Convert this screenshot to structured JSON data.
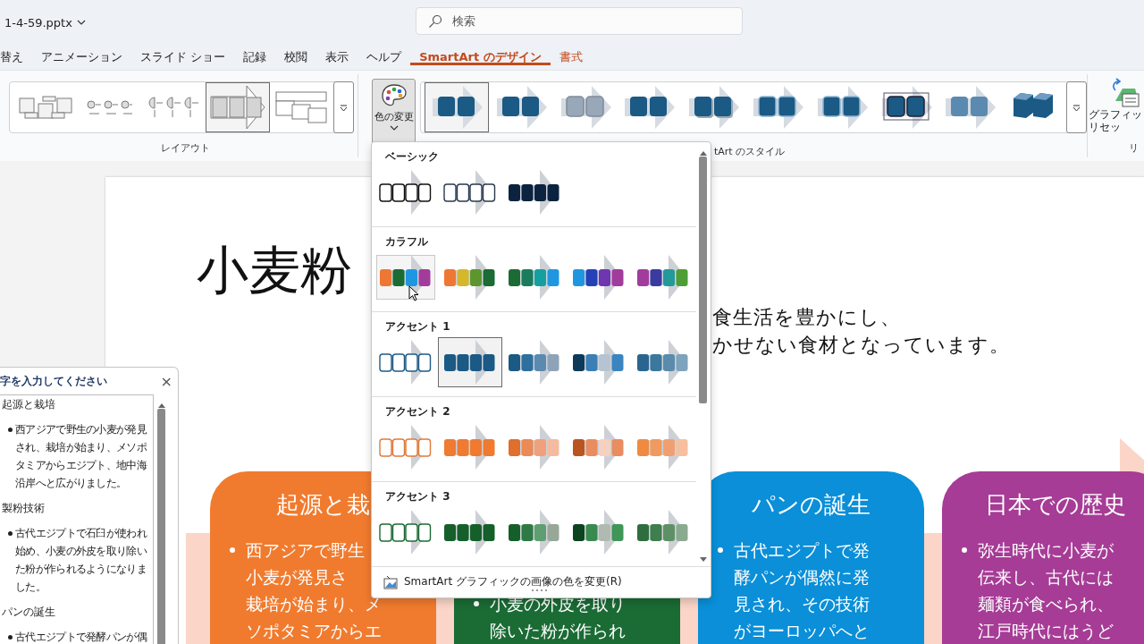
{
  "title_bar": {
    "file_name": "1-4-59.pptx",
    "search": {
      "placeholder": "検索"
    }
  },
  "tabs": [
    {
      "label": "替え",
      "selected": false,
      "kind": "normal"
    },
    {
      "label": "アニメーション",
      "selected": false,
      "kind": "normal"
    },
    {
      "label": "スライド ショー",
      "selected": false,
      "kind": "normal"
    },
    {
      "label": "記録",
      "selected": false,
      "kind": "normal"
    },
    {
      "label": "校閲",
      "selected": false,
      "kind": "normal"
    },
    {
      "label": "表示",
      "selected": false,
      "kind": "normal"
    },
    {
      "label": "ヘルプ",
      "selected": false,
      "kind": "normal"
    },
    {
      "label": "SmartArt のデザイン",
      "selected": true,
      "kind": "contextual"
    },
    {
      "label": "書式",
      "selected": false,
      "kind": "contextual"
    }
  ],
  "ribbon": {
    "layouts": [
      {
        "kind": "cycle",
        "selected": false
      },
      {
        "kind": "dots",
        "selected": false
      },
      {
        "kind": "half-circles",
        "selected": false
      },
      {
        "kind": "arrow-boxes",
        "selected": true
      },
      {
        "kind": "stacked",
        "selected": false
      }
    ],
    "layout_group": "レイアウト",
    "change_colors": {
      "label": "色の変更",
      "expanded": true
    },
    "styles": [
      {
        "kind": "flat",
        "selected": true
      },
      {
        "kind": "flat",
        "selected": false
      },
      {
        "kind": "gray",
        "selected": false
      },
      {
        "kind": "flat",
        "selected": false
      },
      {
        "kind": "shadow",
        "selected": false
      },
      {
        "kind": "bevel",
        "selected": false
      },
      {
        "kind": "bevel",
        "selected": false
      },
      {
        "kind": "outline",
        "selected": false
      },
      {
        "kind": "faded",
        "selected": false
      },
      {
        "kind": "cube",
        "selected": false
      }
    ],
    "styles_group": "tArt のスタイル",
    "reset": {
      "lines": [
        "グラフィッ",
        "リセッ"
      ]
    },
    "reset_group": "リ"
  },
  "color_menu": {
    "sections": [
      {
        "name": "ベーシック",
        "items": [
          {
            "kind": "outline",
            "boxes": [
              {
                "color": "#111111"
              },
              {
                "color": "#111111"
              },
              {
                "color": "#111111"
              },
              {
                "color": "#111111"
              }
            ],
            "selected": false,
            "hovered": false
          },
          {
            "kind": "outline",
            "boxes": [
              {
                "color": "#2a3a50"
              },
              {
                "color": "#2a3a50"
              },
              {
                "color": "#2a3a50"
              },
              {
                "color": "#2a3a50"
              }
            ],
            "selected": false,
            "hovered": false
          },
          {
            "kind": "fill",
            "boxes": [
              {
                "color": "#0c2340"
              },
              {
                "color": "#0c2340"
              },
              {
                "color": "#0c2340"
              },
              {
                "color": "#0c2340"
              }
            ],
            "selected": false,
            "hovered": false
          }
        ]
      },
      {
        "name": "カラフル",
        "items": [
          {
            "kind": "fill",
            "boxes": [
              {
                "color": "#ee7733"
              },
              {
                "color": "#1b6b35"
              },
              {
                "color": "#1f97e0"
              },
              {
                "color": "#a23c9c"
              }
            ],
            "selected": false,
            "hovered": true
          },
          {
            "kind": "fill",
            "boxes": [
              {
                "color": "#ee7733"
              },
              {
                "color": "#d4b82a"
              },
              {
                "color": "#5d962f"
              },
              {
                "color": "#1b6b35"
              }
            ],
            "selected": false,
            "hovered": false
          },
          {
            "kind": "fill",
            "boxes": [
              {
                "color": "#1b6b35"
              },
              {
                "color": "#1a7c5c"
              },
              {
                "color": "#14a0a0"
              },
              {
                "color": "#1f97e0"
              }
            ],
            "selected": false,
            "hovered": false
          },
          {
            "kind": "fill",
            "boxes": [
              {
                "color": "#1f97e0"
              },
              {
                "color": "#2541b8"
              },
              {
                "color": "#7035b0"
              },
              {
                "color": "#a23c9c"
              }
            ],
            "selected": false,
            "hovered": false
          },
          {
            "kind": "fill",
            "boxes": [
              {
                "color": "#a23c9c"
              },
              {
                "color": "#3a3ba0"
              },
              {
                "color": "#23999a"
              },
              {
                "color": "#4f9e35"
              }
            ],
            "selected": false,
            "hovered": false
          }
        ]
      },
      {
        "name": "アクセント 1",
        "items": [
          {
            "kind": "outline",
            "boxes": [
              {
                "color": "#1f5b85"
              },
              {
                "color": "#1f5b85"
              },
              {
                "color": "#1f5b85"
              },
              {
                "color": "#1f5b85"
              }
            ],
            "selected": false,
            "hovered": false
          },
          {
            "kind": "fill",
            "boxes": [
              {
                "color": "#1a5a84"
              },
              {
                "color": "#1a5a84"
              },
              {
                "color": "#1a5a84"
              },
              {
                "color": "#1a5a84"
              }
            ],
            "selected": true,
            "hovered": false
          },
          {
            "kind": "fill",
            "boxes": [
              {
                "color": "#1a5a84"
              },
              {
                "color": "#2e6f9e"
              },
              {
                "color": "#5a8ab0"
              },
              {
                "color": "#8fa3b8"
              }
            ],
            "selected": false,
            "hovered": false
          },
          {
            "kind": "fill",
            "boxes": [
              {
                "color": "#0e3a5a"
              },
              {
                "color": "#3a7fb5"
              },
              {
                "color": "#b6c4d2"
              },
              {
                "color": "#3a85c0"
              }
            ],
            "selected": false,
            "hovered": false
          },
          {
            "kind": "fill",
            "boxes": [
              {
                "color": "#2a6590"
              },
              {
                "color": "#3a789e"
              },
              {
                "color": "#5a8aac"
              },
              {
                "color": "#7ea3bd"
              }
            ],
            "selected": false,
            "hovered": false
          }
        ]
      },
      {
        "name": "アクセント 2",
        "items": [
          {
            "kind": "outline",
            "boxes": [
              {
                "color": "#e07a3a"
              },
              {
                "color": "#e07a3a"
              },
              {
                "color": "#e07a3a"
              },
              {
                "color": "#e07a3a"
              }
            ],
            "selected": false,
            "hovered": false
          },
          {
            "kind": "fill",
            "boxes": [
              {
                "color": "#ef7a30"
              },
              {
                "color": "#ef7a30"
              },
              {
                "color": "#ef7a30"
              },
              {
                "color": "#ef7a30"
              }
            ],
            "selected": false,
            "hovered": false
          },
          {
            "kind": "fill",
            "boxes": [
              {
                "color": "#e06e2c"
              },
              {
                "color": "#ea8a55"
              },
              {
                "color": "#f0a07a"
              },
              {
                "color": "#f4bba0"
              }
            ],
            "selected": false,
            "hovered": false
          },
          {
            "kind": "fill",
            "boxes": [
              {
                "color": "#b85520"
              },
              {
                "color": "#e88d60"
              },
              {
                "color": "#f6d0c0"
              },
              {
                "color": "#e88d60"
              }
            ],
            "selected": false,
            "hovered": false
          },
          {
            "kind": "fill",
            "boxes": [
              {
                "color": "#f08a40"
              },
              {
                "color": "#f09a60"
              },
              {
                "color": "#f0a070"
              },
              {
                "color": "#f6c0a0"
              }
            ],
            "selected": false,
            "hovered": false
          }
        ]
      },
      {
        "name": "アクセント 3",
        "items": [
          {
            "kind": "outline",
            "boxes": [
              {
                "color": "#1d6b35"
              },
              {
                "color": "#1d6b35"
              },
              {
                "color": "#1d6b35"
              },
              {
                "color": "#1d6b35"
              }
            ],
            "selected": false,
            "hovered": false
          },
          {
            "kind": "fill",
            "boxes": [
              {
                "color": "#155f2b"
              },
              {
                "color": "#155f2b"
              },
              {
                "color": "#155f2b"
              },
              {
                "color": "#155f2b"
              }
            ],
            "selected": false,
            "hovered": false
          },
          {
            "kind": "fill",
            "boxes": [
              {
                "color": "#155f2b"
              },
              {
                "color": "#2e7a45"
              },
              {
                "color": "#5e9e70"
              },
              {
                "color": "#98a898"
              }
            ],
            "selected": false,
            "hovered": false
          },
          {
            "kind": "fill",
            "boxes": [
              {
                "color": "#0c4420"
              },
              {
                "color": "#3a8a50"
              },
              {
                "color": "#b0bab0"
              },
              {
                "color": "#3f9657"
              }
            ],
            "selected": false,
            "hovered": false
          },
          {
            "kind": "fill",
            "boxes": [
              {
                "color": "#2e6e3e"
              },
              {
                "color": "#3f7e4e"
              },
              {
                "color": "#5e9066"
              },
              {
                "color": "#8aaa90"
              }
            ],
            "selected": false,
            "hovered": false
          }
        ]
      }
    ],
    "footer": "SmartArt グラフィックの画像の色を変更(R)"
  },
  "text_pane": {
    "title": "字を入力してください",
    "close": "×",
    "items": [
      {
        "text": "起源と栽培",
        "children": [
          {
            "text": "西アジアで野生の小麦が発見され、栽培が始まり、メソポタミアからエジプト、地中海沿岸へと広がりました。"
          }
        ]
      },
      {
        "text": "製粉技術",
        "children": [
          {
            "text": "古代エジプトで石臼が使われ始め、小麦の外皮を取り除いた粉が作られるようになりました。"
          }
        ]
      },
      {
        "text": "パンの誕生",
        "children": [
          {
            "text": "古代エジプトで発酵パンが偶"
          }
        ]
      }
    ]
  },
  "slide": {
    "title": "小麦粉",
    "subtitle_lines": [
      "食生活を豊かにし、",
      "かせない食材となっています。"
    ],
    "cards": [
      {
        "title": "起源と栽",
        "color": "#f07b2e",
        "lines": [
          "西アジアで野生",
          "小麦が発見さ",
          "栽培が始まり、メ",
          "ソポタミアからエ"
        ]
      },
      {
        "color": "#1b6b35",
        "lines": [
          "小麦の外皮を取り",
          "除いた粉が作られ"
        ]
      },
      {
        "title": "パンの誕生",
        "color": "#0a8fd8",
        "lines": [
          "古代エジプトで発",
          "酵パンが偶然に発",
          "見され、その技術",
          "がヨーロッパへと"
        ]
      },
      {
        "title": "日本での歴史",
        "color": "#a63c96",
        "lines": [
          "弥生時代に小麦が",
          "伝来し、古代には",
          "麺類が食べられ、",
          "江戸時代にはうど"
        ]
      }
    ]
  }
}
